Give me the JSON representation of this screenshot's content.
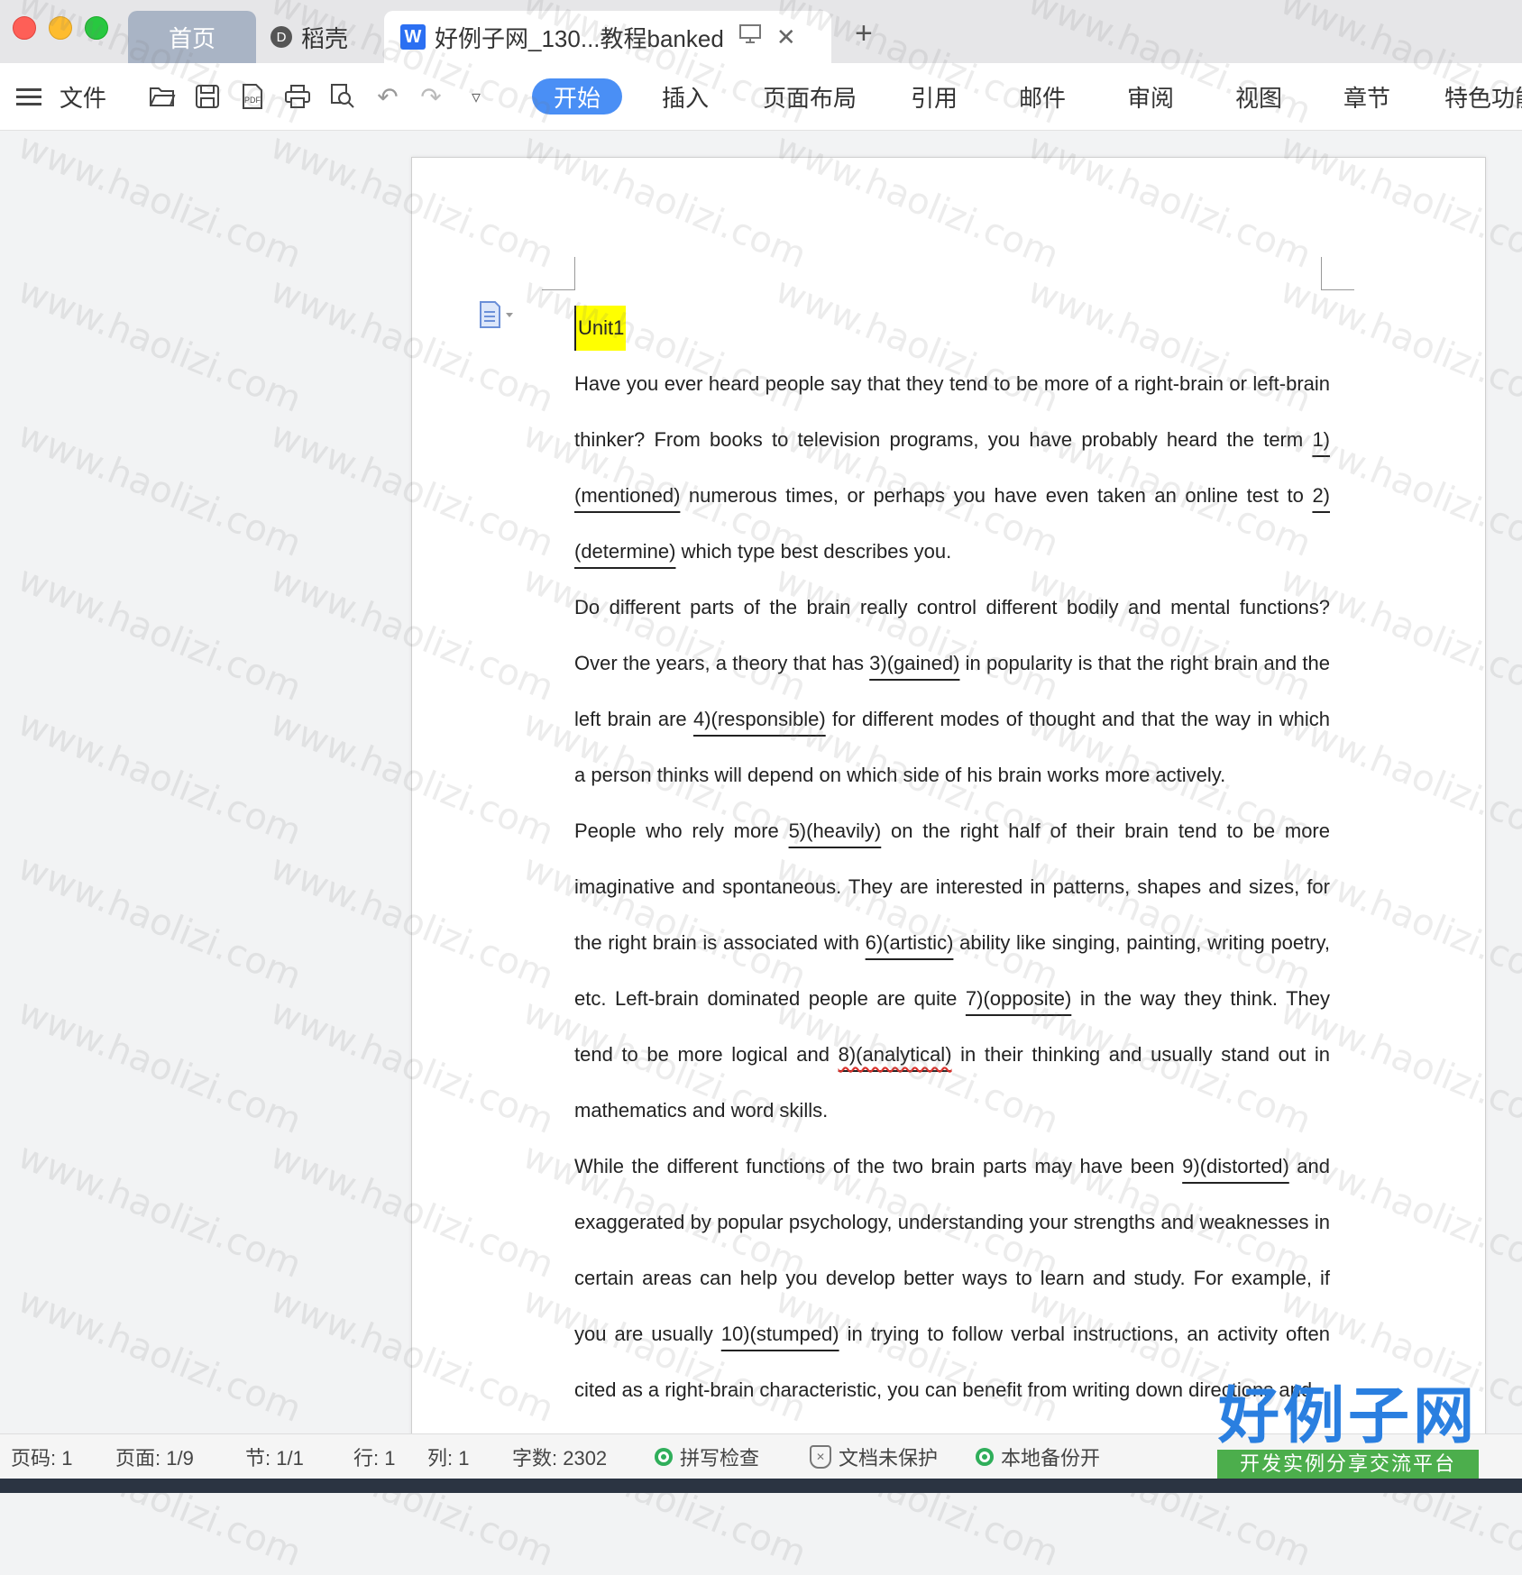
{
  "window": {
    "tabs": [
      {
        "label": "首页"
      },
      {
        "label": "稻壳"
      },
      {
        "label": "好例子网_130...教程banked"
      }
    ],
    "new_tab_icon": "+"
  },
  "toolbar": {
    "file_label": "文件",
    "ribbon_tabs": [
      "开始",
      "插入",
      "页面布局",
      "引用",
      "邮件",
      "审阅",
      "视图",
      "章节",
      "特色功能"
    ],
    "active_tab": "开始"
  },
  "document": {
    "title": "Unit1",
    "paragraphs": [
      {
        "segments": [
          {
            "text": "Have you ever heard people say that they tend to be more of a right-brain or left-brain thinker? From books to television programs, you have probably heard the term "
          },
          {
            "text": "1)(mentioned)",
            "gap": true
          },
          {
            "text": " numerous times, or perhaps you have even taken an online test to "
          },
          {
            "text": "2)(determine)",
            "gap": true
          },
          {
            "text": " which type best describes you."
          }
        ]
      },
      {
        "segments": [
          {
            "text": "Do different parts of the brain really control different bodily and mental functions? Over the years, a theory that has "
          },
          {
            "text": "3)(gained)",
            "gap": true
          },
          {
            "text": " in popularity is that the right brain and the left brain are "
          },
          {
            "text": "4)(responsible)",
            "gap": true
          },
          {
            "text": " for different modes of thought and that the way in which a person thinks will depend on which side of his brain works more actively."
          }
        ]
      },
      {
        "segments": [
          {
            "text": "People who rely more "
          },
          {
            "text": "5)(heavily)",
            "gap": true
          },
          {
            "text": " on the right half of their brain tend to be more imaginative and spontaneous. They are interested in patterns, shapes and sizes, for the right brain is associated with "
          },
          {
            "text": "6)(artistic)",
            "gap": true
          },
          {
            "text": " ability like singing, painting, writing poetry, etc. Left-brain dominated people are quite "
          },
          {
            "text": "7)(opposite)",
            "gap": true
          },
          {
            "text": " in the way they think. They tend to be more logical and "
          },
          {
            "text": "8)(analytical)",
            "gap": true,
            "spell": true
          },
          {
            "text": " in their thinking and usually stand out in mathematics and word skills."
          }
        ]
      },
      {
        "segments": [
          {
            "text": "While the different functions of the two brain parts may have been "
          },
          {
            "text": "9)(distorted)",
            "gap": true
          },
          {
            "text": " and exaggerated by popular psychology, understanding your strengths and weaknesses in certain areas can help you develop better ways to learn and study. For example, if you are usually "
          },
          {
            "text": "10)(stumped)",
            "gap": true
          },
          {
            "text": " in trying to follow verbal instructions, an activity often cited as a right-brain characteristic, you can benefit from writing down directions and"
          }
        ]
      }
    ]
  },
  "watermark": "www.haolizi.com",
  "statusbar": {
    "page_code": "页码: 1",
    "page": "页面: 1/9",
    "section": "节: 1/1",
    "row": "行: 1",
    "col": "列: 1",
    "word_count": "字数: 2302",
    "spell_check": "拼写检查",
    "protect": "文档未保护",
    "backup": "本地备份开"
  },
  "logo": {
    "main": "好例子网",
    "sub": "开发实例分享交流平台"
  },
  "colors": {
    "accent": "#4a8ff5",
    "highlight": "#ffff00",
    "logo_blue": "#2a7fe0",
    "logo_green": "#4cae4c"
  }
}
